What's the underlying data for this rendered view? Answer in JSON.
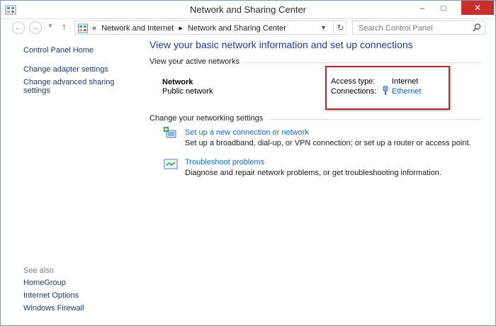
{
  "window": {
    "title": "Network and Sharing Center",
    "minimize": "–",
    "maximize": "□",
    "close": "✕"
  },
  "nav": {
    "back_icon": "back-arrow-icon",
    "forward_icon": "forward-arrow-icon",
    "up_icon": "up-arrow-icon",
    "breadcrumb_prefix": "«",
    "breadcrumb": [
      "Network and Internet",
      "▸",
      "Network and Sharing Center"
    ],
    "search_placeholder": "Search Control Panel"
  },
  "sidebar": {
    "home": "Control Panel Home",
    "adapter": "Change adapter settings",
    "advanced": "Change advanced sharing\nsettings",
    "see_also_label": "See also",
    "see_also": [
      "HomeGroup",
      "Internet Options",
      "Windows Firewall"
    ]
  },
  "main": {
    "heading": "View your basic network information and set up connections",
    "active_section": "View your active networks",
    "network_name": "Network",
    "network_type": "Public network",
    "access_type_label": "Access type:",
    "access_type_value": "Internet",
    "connections_label": "Connections:",
    "connections_value": "Ethernet",
    "change_section": "Change your networking settings",
    "tasks": [
      {
        "link": "Set up a new connection or network",
        "desc": "Set up a broadband, dial-up, or VPN connection; or set up a router or access point."
      },
      {
        "link": "Troubleshoot problems",
        "desc": "Diagnose and repair network problems, or get troubleshooting information."
      }
    ]
  },
  "colors": {
    "link": "#1666c2",
    "heading": "#1e3e8c",
    "close_button": "#c7302a",
    "highlight_border": "#b5262d"
  }
}
